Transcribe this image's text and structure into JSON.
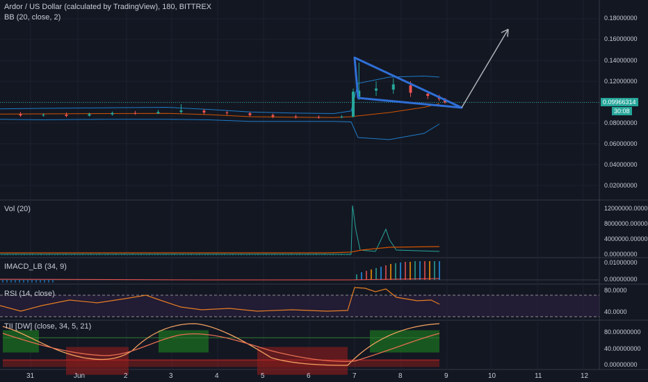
{
  "header": {
    "symbol_line": "Ardor / US Dollar (calculated by TradingView), 180, BITTREX",
    "bb_line": "BB (20, close, 2)"
  },
  "price": {
    "last_price": "0.09966314",
    "countdown": "30:08",
    "y_ticks": [
      "0.18000000",
      "0.16000000",
      "0.14000000",
      "0.12000000",
      "0.08000000",
      "0.06000000",
      "0.04000000",
      "0.02000000"
    ]
  },
  "volume": {
    "title": "Vol (20)",
    "y_ticks": [
      "12000000.00000000",
      "8000000.00000000",
      "4000000.00000000",
      "0.00000000"
    ]
  },
  "imacd": {
    "title": "IMACD_LB (34, 9)",
    "y_ticks": [
      "0.01000000",
      "0.00000000"
    ]
  },
  "rsi": {
    "title": "RSI (14, close)",
    "y_ticks": [
      "80.0000",
      "40.0000"
    ]
  },
  "tii": {
    "title": "TII [DW] (close, 34, 5, 21)",
    "y_ticks": [
      "80.00000000",
      "40.00000000",
      "0.00000000"
    ]
  },
  "x_axis": {
    "ticks": [
      "31",
      "Jun",
      "2",
      "3",
      "4",
      "5",
      "6",
      "7",
      "8",
      "9",
      "10",
      "11",
      "12"
    ]
  },
  "colors": {
    "background": "#131722",
    "grid": "#1e2230",
    "up": "#26a69a",
    "down": "#ef5350",
    "bb_band": "#2196f3",
    "bb_basis": "#d35400",
    "pattern": "#2f6fd6",
    "arrow": "#b0b3b8",
    "price_line": "#26a69a"
  },
  "chart_data": [
    {
      "type": "candlestick",
      "title": "Ardor / US Dollar (calculated by TradingView), 180, BITTREX",
      "ylim": [
        0.01,
        0.19
      ],
      "candles": [
        {
          "x": "2018-05-30 18:00",
          "open": 0.0885,
          "close": 0.0872,
          "high": 0.0905,
          "low": 0.0858
        },
        {
          "x": "2018-05-31 06:00",
          "open": 0.0875,
          "close": 0.0878,
          "high": 0.0892,
          "low": 0.086
        },
        {
          "x": "2018-05-31 18:00",
          "open": 0.088,
          "close": 0.0868,
          "high": 0.09,
          "low": 0.0855
        },
        {
          "x": "2018-06-01 06:00",
          "open": 0.087,
          "close": 0.0885,
          "high": 0.0898,
          "low": 0.0862
        },
        {
          "x": "2018-06-01 18:00",
          "open": 0.0882,
          "close": 0.0896,
          "high": 0.091,
          "low": 0.087
        },
        {
          "x": "2018-06-02 06:00",
          "open": 0.0895,
          "close": 0.089,
          "high": 0.0915,
          "low": 0.0878
        },
        {
          "x": "2018-06-02 18:00",
          "open": 0.0892,
          "close": 0.0905,
          "high": 0.0925,
          "low": 0.0885
        },
        {
          "x": "2018-06-03 06:00",
          "open": 0.0905,
          "close": 0.092,
          "high": 0.098,
          "low": 0.089
        },
        {
          "x": "2018-06-03 18:00",
          "open": 0.0918,
          "close": 0.09,
          "high": 0.0935,
          "low": 0.088
        },
        {
          "x": "2018-06-04 06:00",
          "open": 0.09,
          "close": 0.0895,
          "high": 0.0915,
          "low": 0.0875
        },
        {
          "x": "2018-06-04 18:00",
          "open": 0.0893,
          "close": 0.0875,
          "high": 0.0905,
          "low": 0.086
        },
        {
          "x": "2018-06-05 06:00",
          "open": 0.0876,
          "close": 0.0862,
          "high": 0.089,
          "low": 0.0845
        },
        {
          "x": "2018-06-05 18:00",
          "open": 0.0862,
          "close": 0.0858,
          "high": 0.0878,
          "low": 0.0842
        },
        {
          "x": "2018-06-06 06:00",
          "open": 0.0858,
          "close": 0.0855,
          "high": 0.0872,
          "low": 0.084
        },
        {
          "x": "2018-06-06 18:00",
          "open": 0.0856,
          "close": 0.086,
          "high": 0.0875,
          "low": 0.0845
        },
        {
          "x": "2018-06-07 00:00",
          "open": 0.086,
          "close": 0.11,
          "high": 0.113,
          "low": 0.085
        },
        {
          "x": "2018-06-07 03:00",
          "open": 0.105,
          "close": 0.111,
          "high": 0.138,
          "low": 0.102
        },
        {
          "x": "2018-06-07 12:00",
          "open": 0.111,
          "close": 0.113,
          "high": 0.12,
          "low": 0.106
        },
        {
          "x": "2018-06-07 21:00",
          "open": 0.112,
          "close": 0.117,
          "high": 0.123,
          "low": 0.108
        },
        {
          "x": "2018-06-08 06:00",
          "open": 0.116,
          "close": 0.109,
          "high": 0.12,
          "low": 0.105
        },
        {
          "x": "2018-06-08 15:00",
          "open": 0.108,
          "close": 0.106,
          "high": 0.11,
          "low": 0.103
        },
        {
          "x": "2018-06-08 21:00",
          "open": 0.1055,
          "close": 0.103,
          "high": 0.107,
          "low": 0.101
        },
        {
          "x": "2018-06-09 00:00",
          "open": 0.103,
          "close": 0.0997,
          "high": 0.104,
          "low": 0.0985
        }
      ],
      "last": 0.09966314
    },
    {
      "type": "bar",
      "title": "Vol (20)",
      "ylim": [
        0,
        13500000
      ],
      "note": "spike ~13000000 on Jun 7, ~7000000 on Jun 7-8"
    },
    {
      "type": "line",
      "title": "RSI (14, close)",
      "ylim": [
        30,
        90
      ],
      "bands": [
        70,
        30
      ]
    },
    {
      "type": "line",
      "title": "TII [DW] (close, 34, 5, 21)",
      "ylim": [
        0,
        100
      ]
    }
  ]
}
